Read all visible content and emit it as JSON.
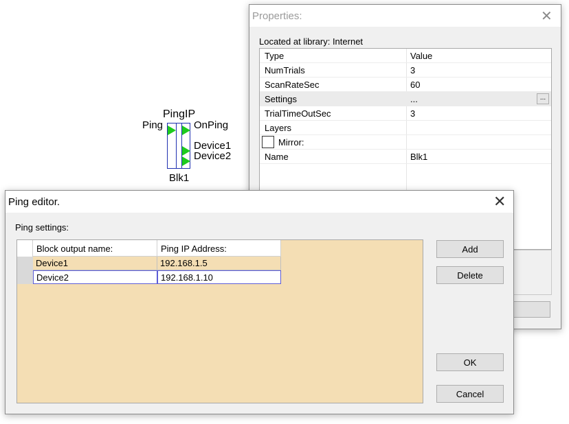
{
  "block": {
    "title": "PingIP",
    "input_label": "Ping",
    "output_labels": [
      "OnPing",
      "Device1",
      "Device2"
    ],
    "name": "Blk1",
    "port_color": "#1ecb1e",
    "border_color": "#1e2fb0"
  },
  "properties": {
    "title": "Properties:",
    "library_text": "Located at library: Internet",
    "headers": {
      "type": "Type",
      "value": "Value"
    },
    "rows": [
      {
        "type": "NumTrials",
        "value": "3"
      },
      {
        "type": "ScanRateSec",
        "value": "60"
      },
      {
        "type": "Settings",
        "value": "...",
        "button": "..."
      },
      {
        "type": "TrialTimeOutSec",
        "value": "3"
      },
      {
        "type": "Layers",
        "value": ""
      },
      {
        "type": "Mirror:",
        "value": "",
        "checkbox": false
      },
      {
        "type": "Name",
        "value": "Blk1"
      }
    ],
    "close_icon": "close-icon"
  },
  "ping_editor": {
    "title": "Ping editor.",
    "settings_label": "Ping settings:",
    "columns": [
      "Block output name:",
      "Ping IP Address:"
    ],
    "rows": [
      {
        "name": "Device1",
        "ip": "192.168.1.5"
      },
      {
        "name": "Device2",
        "ip": "192.168.1.10"
      }
    ],
    "buttons": {
      "add": "Add",
      "delete": "Delete",
      "ok": "OK",
      "cancel": "Cancel"
    },
    "grid_background": "#f4deb4",
    "close_icon": "close-icon"
  }
}
